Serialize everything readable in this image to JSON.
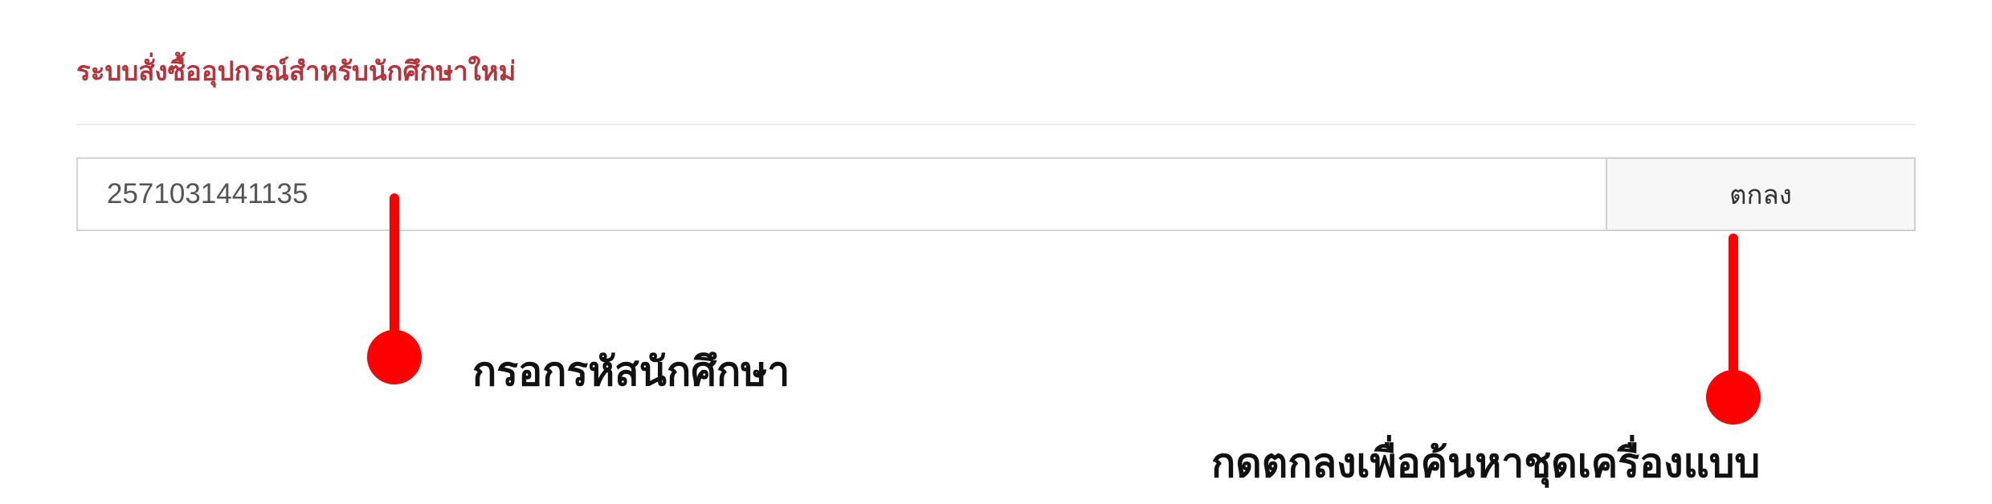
{
  "header": {
    "title": "ระบบสั่งซื้ออุปกรณ์สำหรับนักศึกษาใหม่"
  },
  "search": {
    "value": "2571031441135",
    "submit_label": "ตกลง"
  },
  "annotations": {
    "input_hint": "กรอกรหัสนักศึกษา",
    "button_hint": "กดตกลงเพื่อค้นหาชุดเครื่องแบบ",
    "marker_color": "#ff0000"
  },
  "colors": {
    "title": "#b5333a",
    "border": "#d4d4d4",
    "button_bg": "#f7f7f7"
  }
}
